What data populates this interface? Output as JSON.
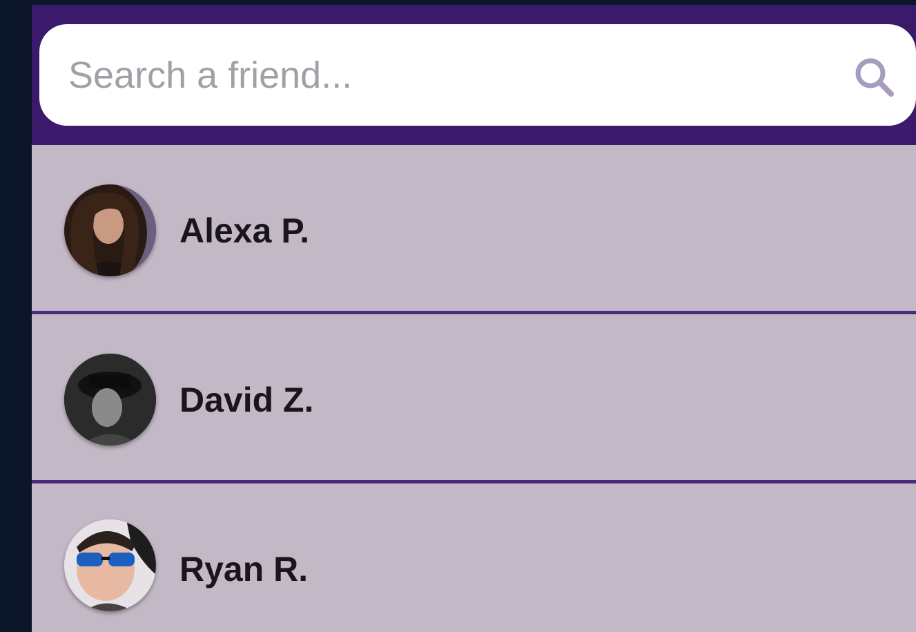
{
  "search": {
    "placeholder": "Search a friend...",
    "value": "",
    "icon": "search-icon"
  },
  "friends": [
    {
      "name": "Alexa P.",
      "avatar": "avatar-alexa"
    },
    {
      "name": "David Z.",
      "avatar": "avatar-david"
    },
    {
      "name": "Ryan R.",
      "avatar": "avatar-ryan"
    }
  ],
  "colors": {
    "background": "#0b1629",
    "header": "#3b1a6c",
    "row": "#c3b8c6",
    "divider": "#4a2a7a",
    "text": "#1a141c"
  }
}
